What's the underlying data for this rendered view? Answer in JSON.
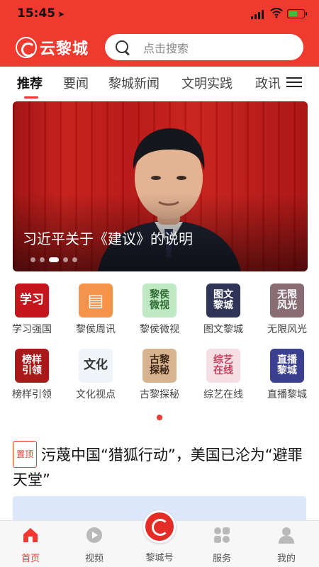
{
  "status": {
    "time": "15:45",
    "location_glyph": "➤"
  },
  "header": {
    "logo_text": "云黎城",
    "search_placeholder": "点击搜索",
    "brand_color": "#ee3a2f"
  },
  "tabs": [
    {
      "label": "推荐",
      "active": true
    },
    {
      "label": "要闻"
    },
    {
      "label": "黎城新闻"
    },
    {
      "label": "文明实践"
    },
    {
      "label": "政讯"
    }
  ],
  "banner": {
    "caption": "习近平关于《建议》的说明",
    "slide_count": 5,
    "active_slide": 3
  },
  "grid": [
    {
      "label": "学习强国",
      "icon_text": "学习",
      "icon": "xuexi-qiangguo-icon",
      "bg": "#c4161c",
      "fg": "#ffffff"
    },
    {
      "label": "黎侯周讯",
      "icon_text": "▤",
      "icon": "newspaper-icon",
      "bg": "#f5934a",
      "fg": "#ffffff"
    },
    {
      "label": "黎侯微视",
      "icon_text": "黎侯微视",
      "icon": "lihou-weishi-icon",
      "bg": "#bfe9c2",
      "fg": "#2f6b34"
    },
    {
      "label": "图文黎城",
      "icon_text": "图文黎城",
      "icon": "tuwen-licheng-icon",
      "bg": "#2e3557",
      "fg": "#ffffff"
    },
    {
      "label": "无限风光",
      "icon_text": "无限风光",
      "icon": "wuxian-fengguang-icon",
      "bg": "#8a6d74",
      "fg": "#ffffff"
    },
    {
      "label": "榜样引领",
      "icon_text": "榜样引领",
      "icon": "bangyang-yinling-icon",
      "bg": "#a81a1a",
      "fg": "#ffffff"
    },
    {
      "label": "文化视点",
      "icon_text": "文化",
      "icon": "wenhua-shidian-icon",
      "bg": "#eef4f7",
      "fg": "#333333"
    },
    {
      "label": "古黎探秘",
      "icon_text": "古黎探秘",
      "icon": "guli-tanmi-icon",
      "bg": "#d7b48f",
      "fg": "#3a2417"
    },
    {
      "label": "综艺在线",
      "icon_text": "综艺在线",
      "icon": "zongyi-zaixian-icon",
      "bg": "#f6dfe4",
      "fg": "#c2415c"
    },
    {
      "label": "直播黎城",
      "icon_text": "直播黎城",
      "icon": "zhibo-licheng-icon",
      "bg": "#3a3f8f",
      "fg": "#ffffff"
    }
  ],
  "news": {
    "pin_label": "置顶",
    "title": "污蔑中国“猎狐行动”，美国已沦为“避罪天堂”"
  },
  "bottom_nav": [
    {
      "label": "首页",
      "icon": "home-icon",
      "active": true
    },
    {
      "label": "视频",
      "icon": "video-play-icon"
    },
    {
      "label": "黎城号",
      "icon": "licheng-logo-icon"
    },
    {
      "label": "服务",
      "icon": "services-grid-icon"
    },
    {
      "label": "我的",
      "icon": "user-profile-icon"
    }
  ]
}
